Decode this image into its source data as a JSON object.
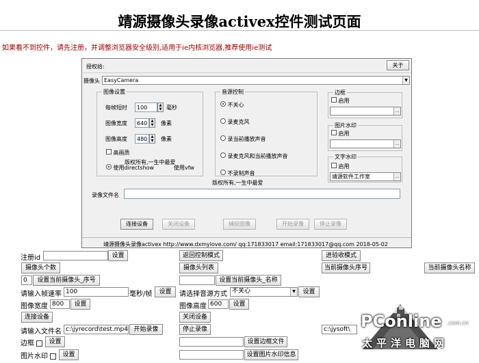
{
  "page": {
    "title": "靖源摄像头录像activex控件测试页面",
    "notice": "如果看不到控件，请先注册，并调整浏览器安全级别,适用于ie内核浏览器,推荐使用ie测试"
  },
  "control": {
    "auth_label": "授权给:",
    "about_button": "关于",
    "camera_label": "摄像头",
    "camera_value": "EasyCamera",
    "image_group": {
      "title": "图像设置",
      "interval_label": "每帧短时",
      "interval_value": "100",
      "interval_unit": "毫秒",
      "width_label": "图像宽度",
      "width_value": "640",
      "width_unit": "像素",
      "height_label": "图像高度",
      "height_value": "480",
      "height_unit": "像素",
      "hd_label": "高画质",
      "overlay_text": "版权所有,一生中最爱",
      "engine_label": "使用directshow",
      "vfw_label": "使用vfw"
    },
    "audio_group": {
      "title": "音源控制",
      "options": [
        "不关心",
        "录麦克风",
        "录当前播放声音",
        "录麦克风和当前播放声音",
        "不录制声音"
      ],
      "copyright": "版权所有,一生中最爱"
    },
    "border_group": {
      "title": "边框",
      "enable_label": "启用"
    },
    "image_wm_group": {
      "title": "图片水印",
      "enable_label": "启用"
    },
    "text_wm_group": {
      "title": "文字水印",
      "enable_label": "启用",
      "text_value": "靖源软件工作室"
    },
    "filename_label": "录像文件名",
    "buttons": {
      "connect": "连接设备",
      "disconnect": "关闭设备",
      "capture": "捕捉图像",
      "start_record": "开始录像",
      "stop_record": "停止录像"
    },
    "footer": "靖源摄像头录像activex http://www.dxmylove.com/ qq:171833017 email:171833017@qq.com 2018-05-02"
  },
  "form": {
    "register_label": "注册id",
    "register_button": "设置",
    "return_button": "返回控制模式",
    "advanced_button": "进验收模式",
    "camera_count_button": "摄像头个数",
    "camera_list_button": "摄像头列表",
    "current_index_button": "当前摄像头序号",
    "current_name_button": "当前摄像头名称",
    "index_value": "0",
    "set_index_button": "设置当前摄像头_序号",
    "set_name_button": "设置当前摄像头_名称",
    "fps_label": "请输入帧速率",
    "fps_value": "100",
    "fps_unit": "毫秒/帧",
    "fps_button": "设置",
    "audio_label": "请选择音源方式",
    "audio_value": "不关心",
    "audio_button": "设置",
    "width_label": "图像宽度",
    "width_value": "800",
    "width_button": "设置",
    "height_label": "图像高度",
    "height_value": "600",
    "height_button": "设置",
    "connect_button": "连接设备",
    "close_button": "关闭设备",
    "file_label": "请输入文件名",
    "file_value": "c:\\jyrecord\\test.mp4",
    "start_button": "开始录像",
    "stop_button": "停止录像",
    "right_file_value": "c:\\jysoft\\",
    "border_label": "边框",
    "border_button": "设置",
    "border_file_button": "设置边框文件",
    "image_wm_label": "图片水印",
    "image_wm_button": "设置",
    "image_wm_info_button": "设置图片水印信息"
  },
  "watermark": {
    "brand": "PConline",
    "domain": ".com.cn",
    "tagline": "太平洋电脑网",
    "red": "#d8232a"
  }
}
